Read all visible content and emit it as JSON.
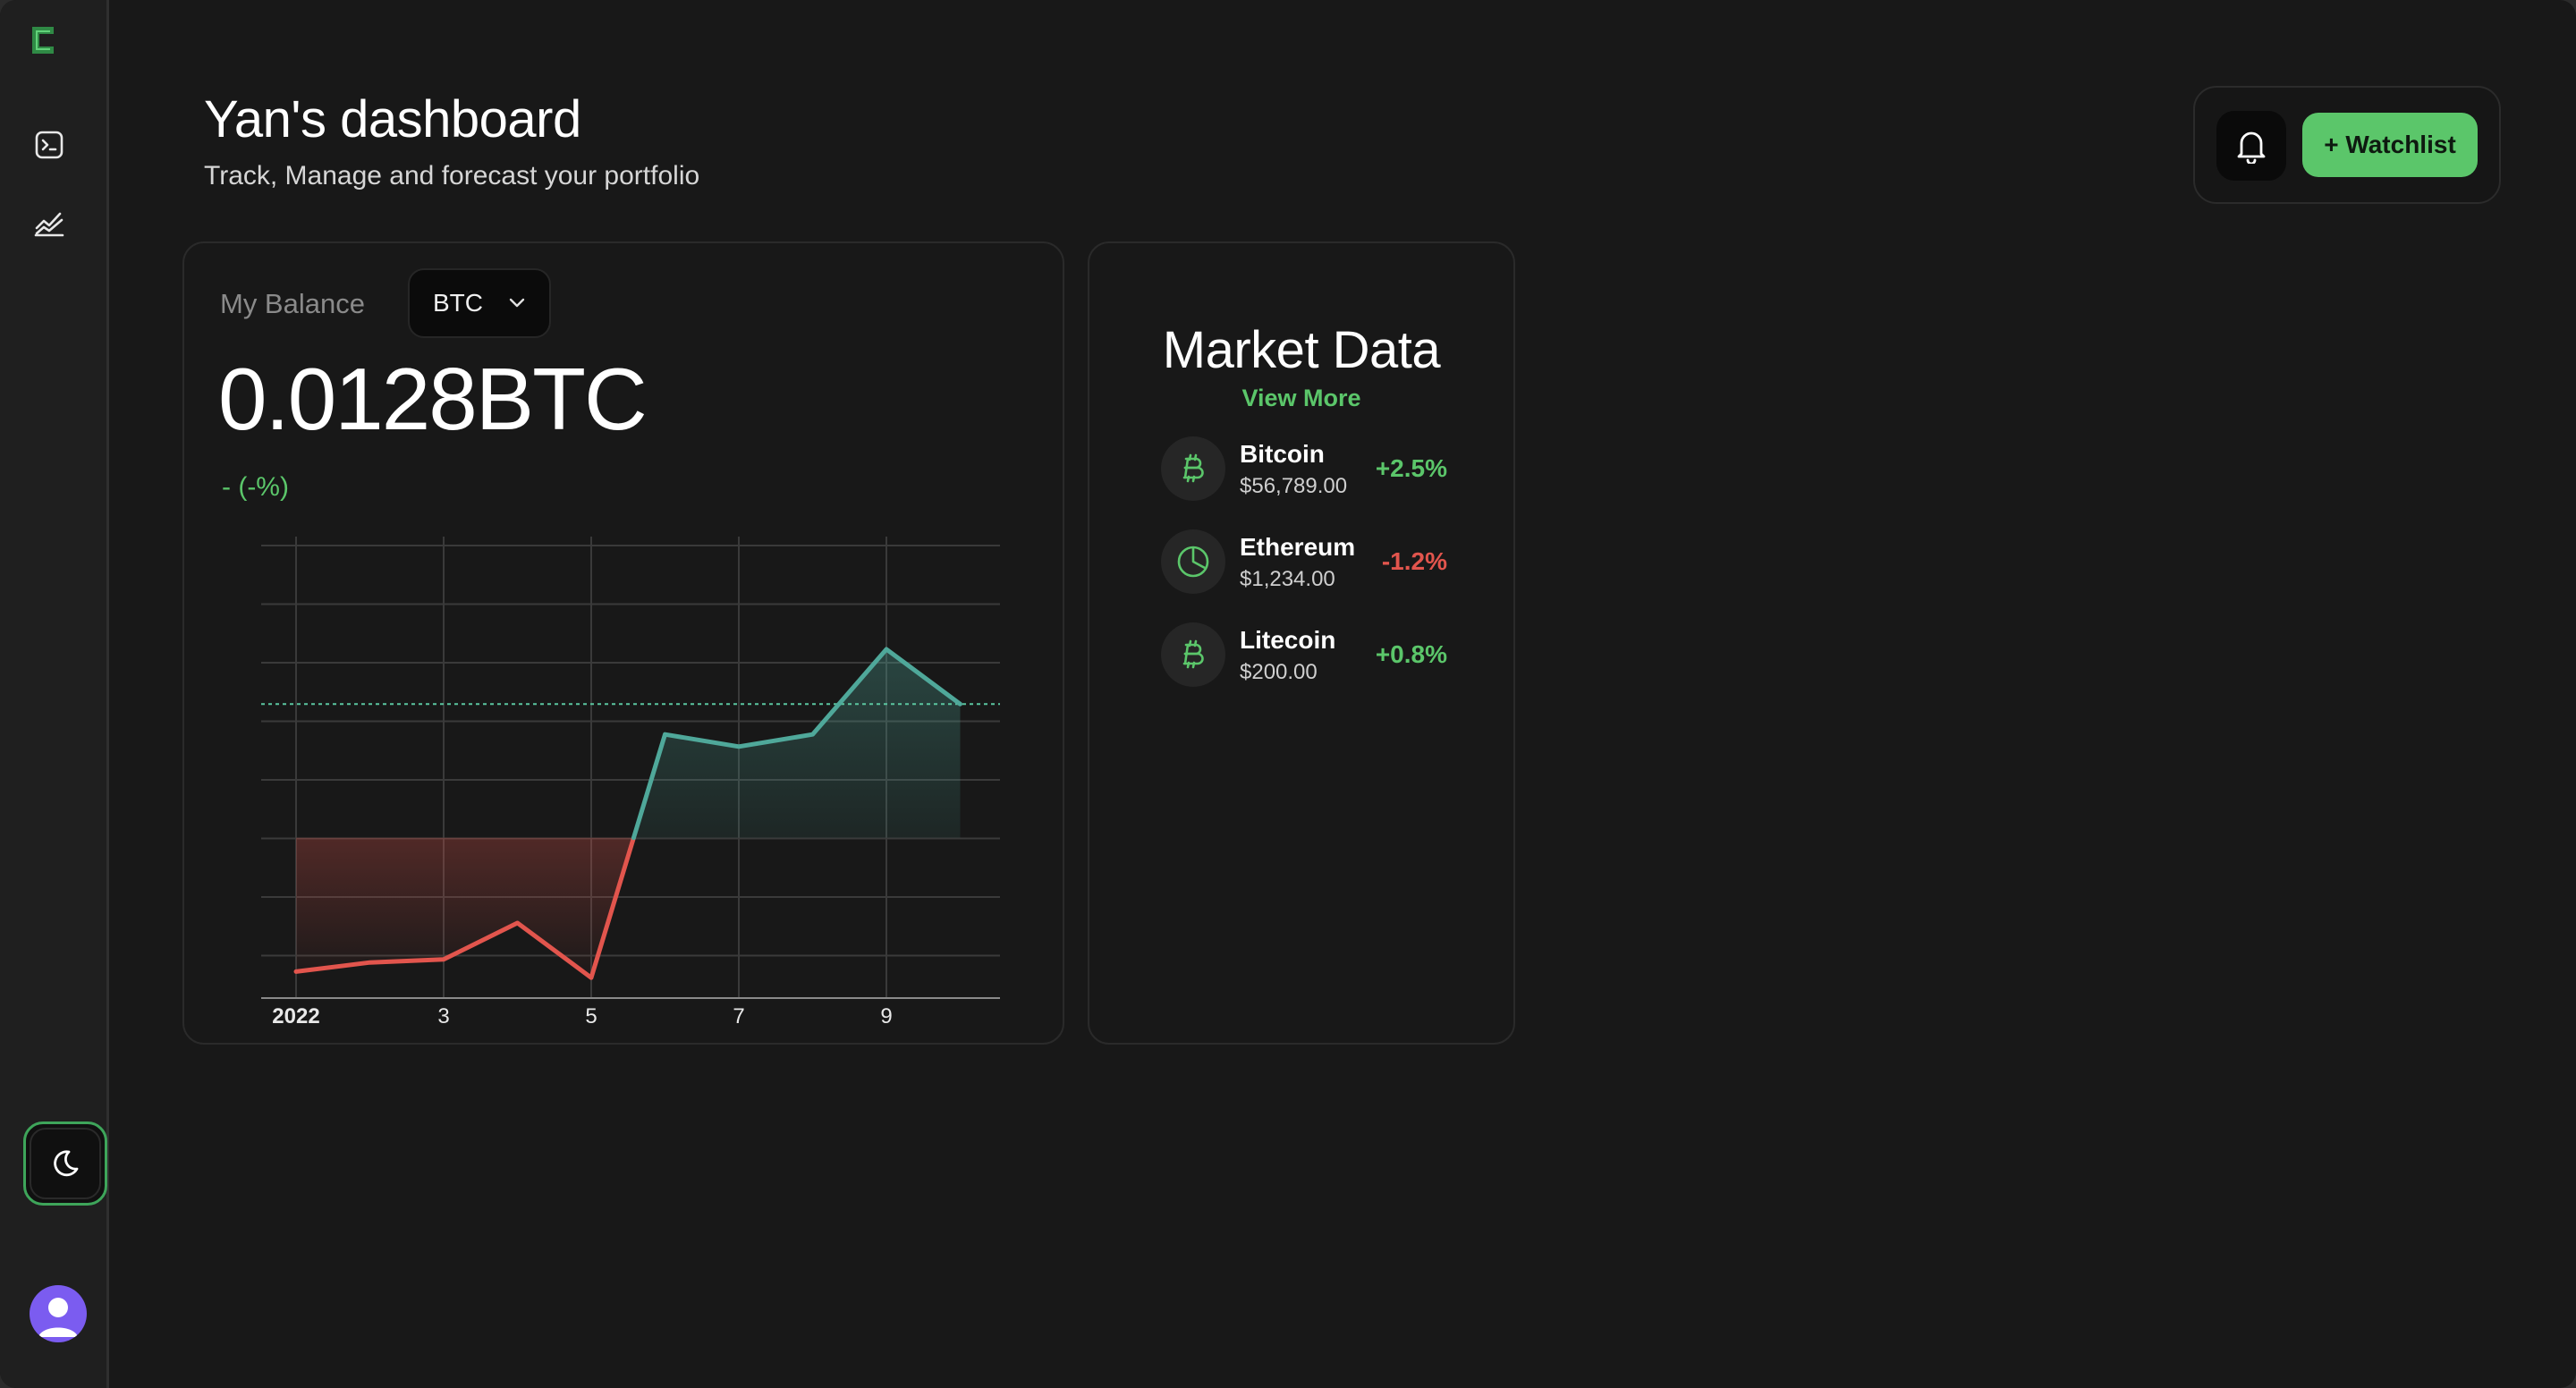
{
  "header": {
    "title": "Yan's dashboard",
    "subtitle": "Track, Manage and forecast your portfolio",
    "watchlist_label": "+ Watchlist"
  },
  "sidebar": {
    "items": [
      {
        "icon": "terminal-icon"
      },
      {
        "icon": "chart-line-icon"
      }
    ],
    "theme_icon": "moon-icon",
    "avatar_icon": "user-icon"
  },
  "balance": {
    "label": "My Balance",
    "currency": "BTC",
    "value": "0.0128BTC",
    "change": "- (-%)"
  },
  "market": {
    "title": "Market Data",
    "view_more": "View More",
    "items": [
      {
        "name": "Bitcoin",
        "price": "$56,789.00",
        "change": "+2.5%",
        "trend": "up",
        "icon": "bitcoin-icon"
      },
      {
        "name": "Ethereum",
        "price": "$1,234.00",
        "change": "-1.2%",
        "trend": "down",
        "icon": "pie-chart-icon"
      },
      {
        "name": "Litecoin",
        "price": "$200.00",
        "change": "+0.8%",
        "trend": "up",
        "icon": "bitcoin-icon"
      }
    ]
  },
  "colors": {
    "accent": "#5bc66a",
    "down": "#e2554d",
    "up_line": "#4fa89a",
    "background": "#181818"
  },
  "chart_data": {
    "type": "line",
    "x_ticks": [
      "2022",
      "3",
      "5",
      "7",
      "9"
    ],
    "x": [
      1,
      2,
      3,
      4,
      5,
      6,
      7,
      8,
      9,
      10
    ],
    "values": [
      2,
      3.5,
      4,
      10,
      1,
      41,
      39,
      41,
      55,
      46
    ],
    "baseline": 46,
    "ylim": [
      0,
      70
    ],
    "grid": true
  }
}
